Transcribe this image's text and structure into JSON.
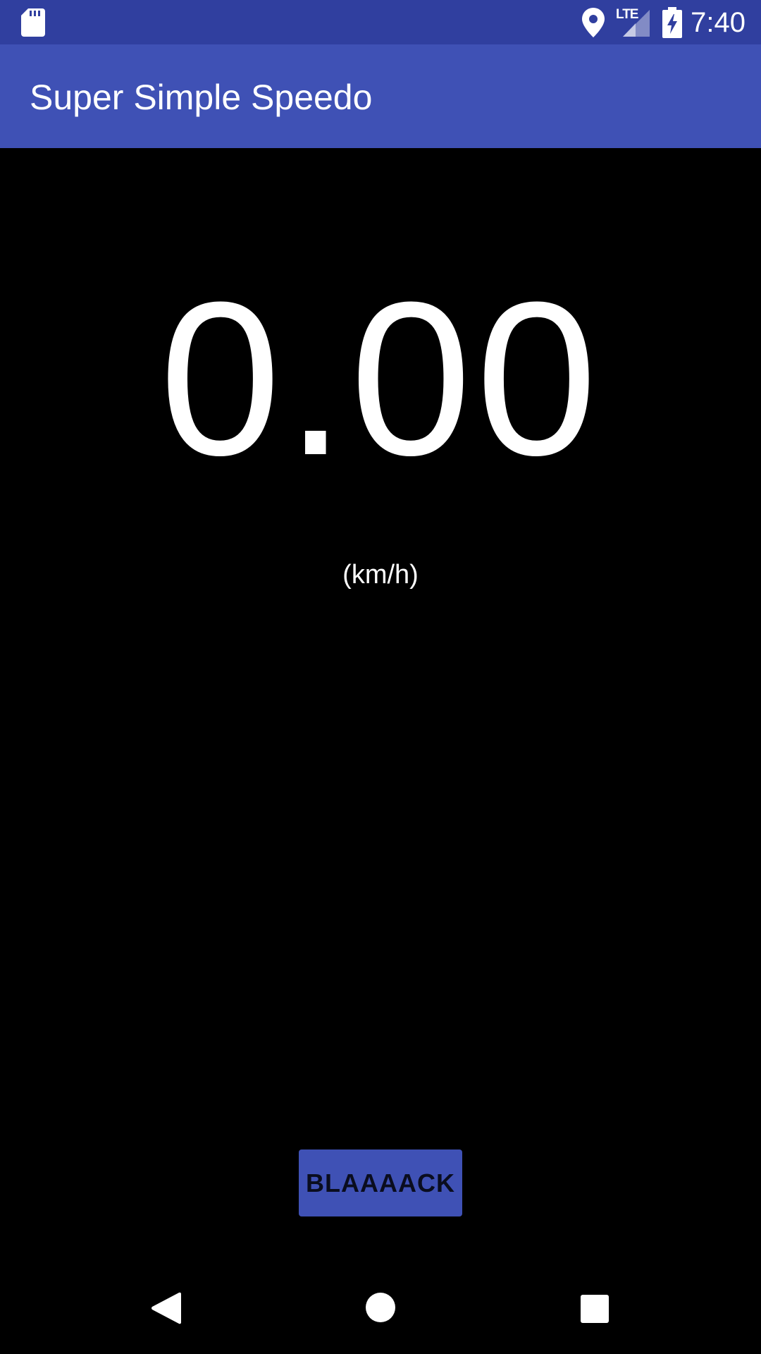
{
  "status_bar": {
    "time": "7:40",
    "network_label": "LTE",
    "icons": [
      "sd-card-icon",
      "location-icon",
      "lte-signal-icon",
      "battery-charging-icon"
    ]
  },
  "app_bar": {
    "title": "Super Simple Speedo"
  },
  "speedometer": {
    "speed": "0.00",
    "unit": "(km/h)"
  },
  "button": {
    "label": "BLAAAACK"
  },
  "nav_bar": {
    "icons": [
      "back-icon",
      "home-icon",
      "recents-icon"
    ]
  },
  "colors": {
    "status_bar": "#303f9f",
    "app_bar": "#3f51b5",
    "background": "#000000",
    "text": "#ffffff",
    "button": "#3f51b5"
  }
}
